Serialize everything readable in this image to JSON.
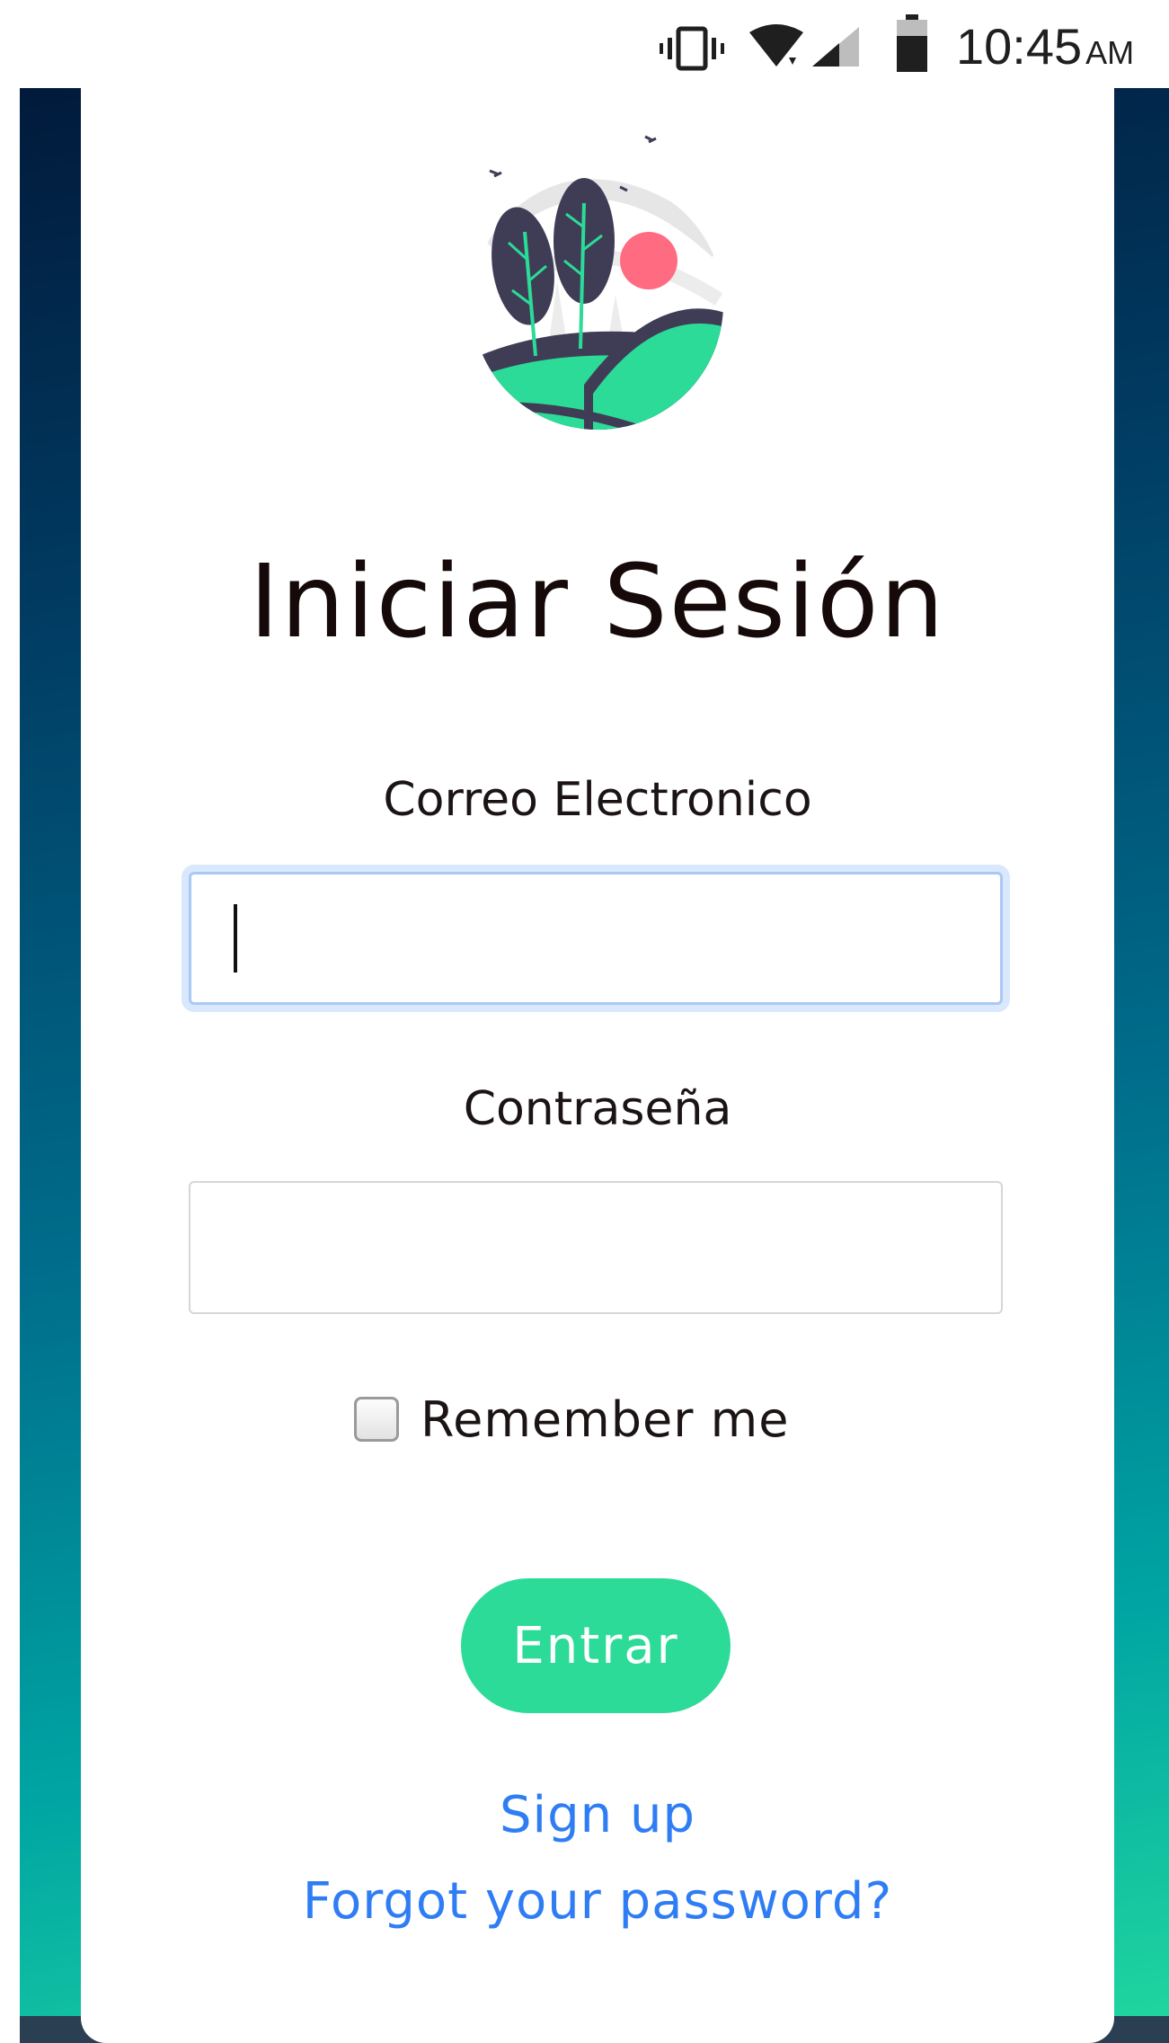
{
  "status_bar": {
    "time": "10:45",
    "ampm": "AM",
    "icons": [
      "vibrate-icon",
      "wifi-icon",
      "signal-icon",
      "battery-icon"
    ]
  },
  "login": {
    "title": "Iniciar Sesión",
    "email_label": "Correo Electronico",
    "email_value": "",
    "password_label": "Contraseña",
    "password_value": "",
    "remember_label": "Remember me",
    "remember_checked": false,
    "submit_label": "Entrar",
    "signup_link": "Sign up",
    "forgot_link": "Forgot your password?"
  },
  "colors": {
    "accent": "#2bdb97",
    "link": "#2f7df4",
    "gradient_start": "#011a3b",
    "gradient_end": "#22d89f",
    "sun": "#ff6b81",
    "tree": "#3f3d56"
  }
}
